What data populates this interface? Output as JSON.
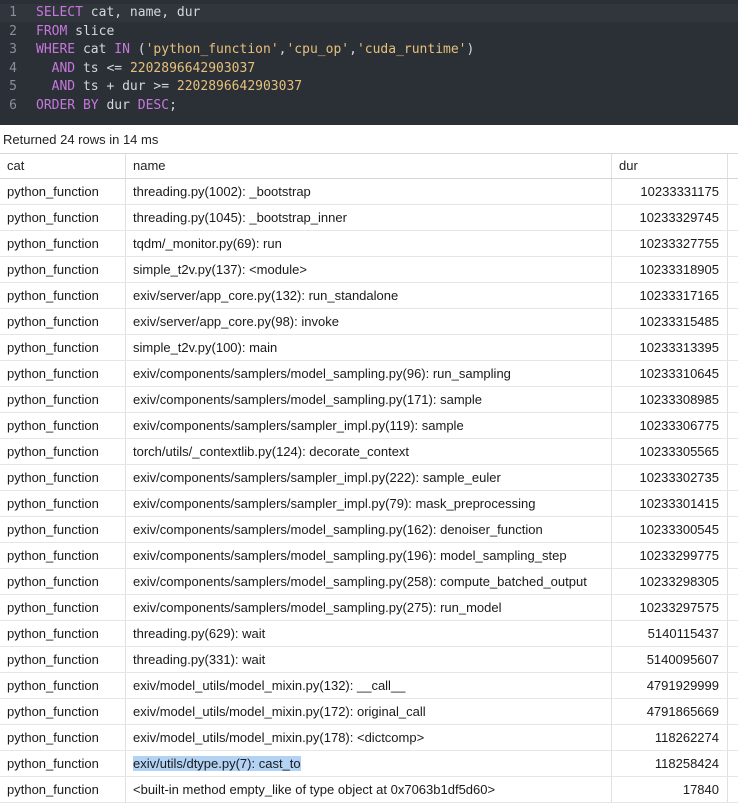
{
  "query": {
    "lines": [
      {
        "num": "1",
        "tokens": [
          {
            "t": "SELECT",
            "c": "kw"
          },
          {
            "t": " cat, name, dur",
            "c": ""
          }
        ]
      },
      {
        "num": "2",
        "tokens": [
          {
            "t": "FROM",
            "c": "kw"
          },
          {
            "t": " slice",
            "c": ""
          }
        ]
      },
      {
        "num": "3",
        "tokens": [
          {
            "t": "WHERE",
            "c": "kw"
          },
          {
            "t": " cat ",
            "c": ""
          },
          {
            "t": "IN",
            "c": "kw"
          },
          {
            "t": " (",
            "c": ""
          },
          {
            "t": "'python_function'",
            "c": "str"
          },
          {
            "t": ",",
            "c": ""
          },
          {
            "t": "'cpu_op'",
            "c": "str"
          },
          {
            "t": ",",
            "c": ""
          },
          {
            "t": "'cuda_runtime'",
            "c": "str"
          },
          {
            "t": ")",
            "c": ""
          }
        ]
      },
      {
        "num": "4",
        "tokens": [
          {
            "t": "  ",
            "c": ""
          },
          {
            "t": "AND",
            "c": "kw"
          },
          {
            "t": " ts <= ",
            "c": ""
          },
          {
            "t": "2202896642903037",
            "c": "num"
          }
        ]
      },
      {
        "num": "5",
        "tokens": [
          {
            "t": "  ",
            "c": ""
          },
          {
            "t": "AND",
            "c": "kw"
          },
          {
            "t": " ts + dur >= ",
            "c": ""
          },
          {
            "t": "2202896642903037",
            "c": "num"
          }
        ]
      },
      {
        "num": "6",
        "tokens": [
          {
            "t": "ORDER BY",
            "c": "kw"
          },
          {
            "t": " dur ",
            "c": ""
          },
          {
            "t": "DESC",
            "c": "kw"
          },
          {
            "t": ";",
            "c": ""
          }
        ]
      }
    ]
  },
  "status": "Returned 24 rows in 14 ms",
  "columns": [
    "cat",
    "name",
    "dur"
  ],
  "rows": [
    {
      "cat": "python_function",
      "name": "threading.py(1002): _bootstrap",
      "dur": "10233331175"
    },
    {
      "cat": "python_function",
      "name": "threading.py(1045): _bootstrap_inner",
      "dur": "10233329745"
    },
    {
      "cat": "python_function",
      "name": "tqdm/_monitor.py(69): run",
      "dur": "10233327755"
    },
    {
      "cat": "python_function",
      "name": "simple_t2v.py(137): <module>",
      "dur": "10233318905"
    },
    {
      "cat": "python_function",
      "name": "exiv/server/app_core.py(132): run_standalone",
      "dur": "10233317165"
    },
    {
      "cat": "python_function",
      "name": "exiv/server/app_core.py(98): invoke",
      "dur": "10233315485"
    },
    {
      "cat": "python_function",
      "name": "simple_t2v.py(100): main",
      "dur": "10233313395"
    },
    {
      "cat": "python_function",
      "name": "exiv/components/samplers/model_sampling.py(96): run_sampling",
      "dur": "10233310645"
    },
    {
      "cat": "python_function",
      "name": "exiv/components/samplers/model_sampling.py(171): sample",
      "dur": "10233308985"
    },
    {
      "cat": "python_function",
      "name": "exiv/components/samplers/sampler_impl.py(119): sample",
      "dur": "10233306775"
    },
    {
      "cat": "python_function",
      "name": "torch/utils/_contextlib.py(124): decorate_context",
      "dur": "10233305565"
    },
    {
      "cat": "python_function",
      "name": "exiv/components/samplers/sampler_impl.py(222): sample_euler",
      "dur": "10233302735"
    },
    {
      "cat": "python_function",
      "name": "exiv/components/samplers/sampler_impl.py(79): mask_preprocessing",
      "dur": "10233301415"
    },
    {
      "cat": "python_function",
      "name": "exiv/components/samplers/model_sampling.py(162): denoiser_function",
      "dur": "10233300545"
    },
    {
      "cat": "python_function",
      "name": "exiv/components/samplers/model_sampling.py(196): model_sampling_step",
      "dur": "10233299775"
    },
    {
      "cat": "python_function",
      "name": "exiv/components/samplers/model_sampling.py(258): compute_batched_output",
      "dur": "10233298305"
    },
    {
      "cat": "python_function",
      "name": "exiv/components/samplers/model_sampling.py(275): run_model",
      "dur": "10233297575"
    },
    {
      "cat": "python_function",
      "name": "threading.py(629): wait",
      "dur": "5140115437"
    },
    {
      "cat": "python_function",
      "name": "threading.py(331): wait",
      "dur": "5140095607"
    },
    {
      "cat": "python_function",
      "name": "exiv/model_utils/model_mixin.py(132): __call__",
      "dur": "4791929999"
    },
    {
      "cat": "python_function",
      "name": "exiv/model_utils/model_mixin.py(172): original_call",
      "dur": "4791865669"
    },
    {
      "cat": "python_function",
      "name": "exiv/model_utils/model_mixin.py(178): <dictcomp>",
      "dur": "118262274"
    },
    {
      "cat": "python_function",
      "name": "exiv/utils/dtype.py(7): cast_to",
      "dur": "118258424",
      "selected": true
    },
    {
      "cat": "python_function",
      "name": "<built-in method empty_like of type object at 0x7063b1df5d60>",
      "dur": "17840"
    }
  ]
}
